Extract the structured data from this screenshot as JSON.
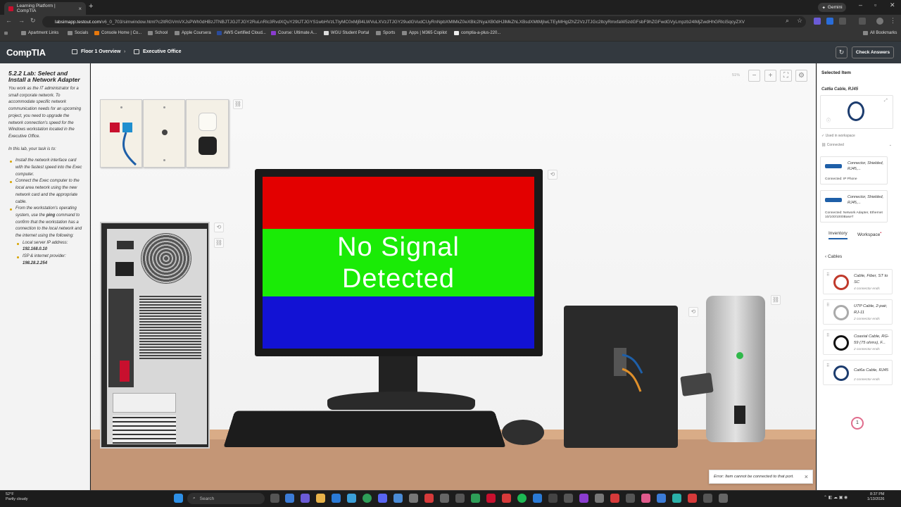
{
  "browser": {
    "tab_title": "Learning Platform | CompTIA",
    "tab_close": "×",
    "new_tab": "+",
    "gemini_label": "Gemini",
    "url_host": "labsimapp.testout.com",
    "url_path": "/v6_0_703/simwindow.html?c2ltRGVmVXJsPWh0dHBzJTNBJTJGJTJGY2RuLnRlc3RvdXQuY29tJTJGYS1wbHVzLTIyMC0xMjB4LWVuLXVzJTJGY29udGVudCUyRnNpbXMlMkZ0eXBlc2NyaXB0dHJlMkZhLXBsdXMtMjIwLTEyMHgtZhZ2VzJTJGc2ltcyRmxfaW5zdGFsbF9hZGFwdGVyLmpzb24lMjZwdHhGRlciSqcyZXV",
    "bookmarks": [
      "Apartment Links",
      "Socials",
      "Console Home | Co...",
      "School",
      "Apple Coursera",
      "AWS Certified Cloud...",
      "Course: Ultimate A...",
      "WGU Student Portal",
      "Sports",
      "Apps | M365 Copilot",
      "comptia-a-plus-220..."
    ],
    "all_bookmarks": "All Bookmarks"
  },
  "app": {
    "logo": "CompTIA",
    "crumb1": "Floor 1 Overview",
    "crumb_sep": "›",
    "crumb2": "Executive Office",
    "check_answers": "Check Answers"
  },
  "lab": {
    "title": "5.2.2 Lab: Select and Install a Network Adapter",
    "intro": "You work as the IT administrator for a small corporate network. To accommodate specific network communication needs for an upcoming project, you need to upgrade the network connection's speed for the Windows workstation located in the Executive Office.",
    "task_intro": "In this lab, your task is to:",
    "task1": "Install the network interface card with the fastest speed into the Exec computer.",
    "task2": "Connect the Exec computer to the local area network using the new network card and the appropriate cable.",
    "task3a": "From the workstation's operating system, use the ",
    "task3_cmd": "ping",
    "task3b": " command to confirm that the workstation has a connection to the local network and the internet using the following:",
    "sub1": "Local server IP address:",
    "ip1": "192.168.0.10",
    "sub2": "ISP & internet provider:",
    "ip2": "198.28.2.254"
  },
  "workspace": {
    "zoom": "51%",
    "screen_text_line1": "No Signal",
    "screen_text_line2": "Detected",
    "colors": {
      "red": "#e30000",
      "green": "#1aeb06",
      "blue": "#1212d4"
    }
  },
  "selected": {
    "header": "Selected Item",
    "name": "Cat6a Cable, RJ45",
    "used": "Used in workspace",
    "connected": "Connected",
    "conn1_label": "Connector, Shielded, RJ45,...",
    "conn1_status": "Connected: IP Phone",
    "conn2_label": "Connector, Shielded, RJ45,...",
    "conn2_status": "Connected: Network Adapter, Ethernet 10/100/1000BaseT"
  },
  "inventory": {
    "tab_inventory": "Inventory",
    "tab_workspace": "Workspace",
    "back_label": "Cables",
    "items": [
      {
        "name": "Cable, Fiber, ST to SC",
        "ends": "4 connector ends"
      },
      {
        "name": "UTP Cable, 2-pair, RJ-11",
        "ends": "2 connector ends"
      },
      {
        "name": "Coaxial Cable, RG-59 (75 ohms), F...",
        "ends": "2 connector ends"
      },
      {
        "name": "Cat6a Cable, RJ45",
        "ends": "2 connector ends"
      }
    ]
  },
  "toast": {
    "message": "Error: Item cannot be connected to that port.",
    "close": "×"
  },
  "badge": "1",
  "taskbar": {
    "temp": "52°F",
    "weather": "Partly cloudy",
    "search": "Search",
    "time": "8:37 PM",
    "date": "1/13/2026"
  }
}
